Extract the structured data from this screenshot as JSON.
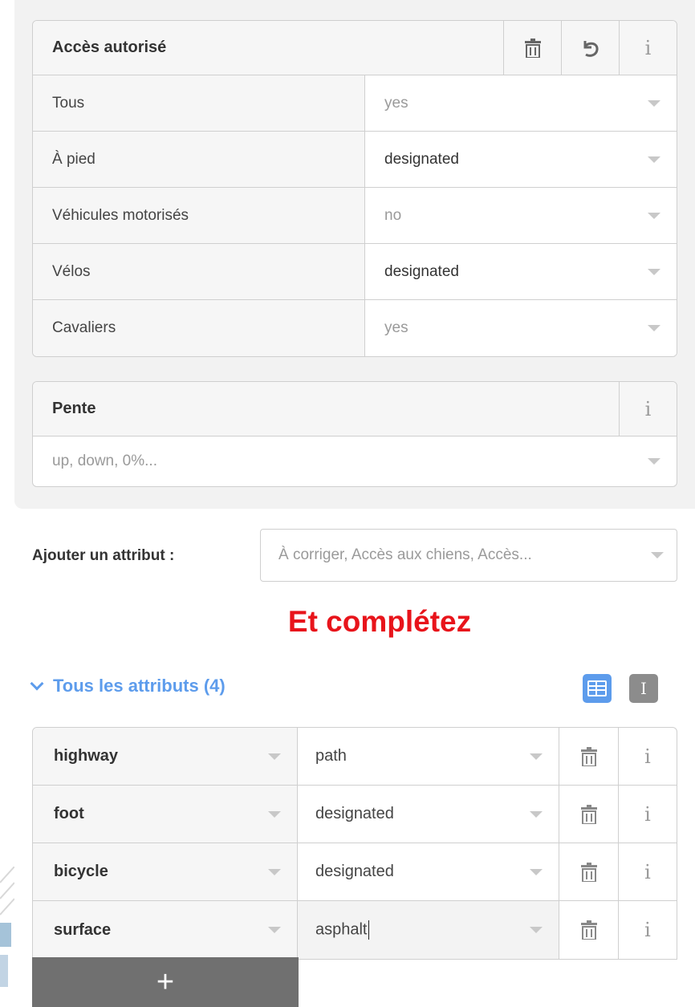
{
  "access_card": {
    "title": "Accès autorisé",
    "delete_icon": "trash-icon",
    "undo_icon": "undo-icon",
    "info_label": "i",
    "rows": [
      {
        "label": "Tous",
        "value": "yes",
        "state": "placeholder"
      },
      {
        "label": "À pied",
        "value": "designated",
        "state": "filled"
      },
      {
        "label": "Véhicules motorisés",
        "value": "no",
        "state": "placeholder"
      },
      {
        "label": "Vélos",
        "value": "designated",
        "state": "filled"
      },
      {
        "label": "Cavaliers",
        "value": "yes",
        "state": "placeholder"
      }
    ]
  },
  "incline_card": {
    "title": "Pente",
    "info_label": "i",
    "placeholder": "up, down, 0%..."
  },
  "add_field": {
    "label": "Ajouter un attribut :",
    "placeholder": "À corriger, Accès aux chiens, Accès..."
  },
  "annotation": {
    "text": "Et complétez",
    "color": "#e8141b"
  },
  "all_tags": {
    "toggle_label": "Tous les attributs (4)",
    "accent": "#5d9cec",
    "text_view_label": "I",
    "rows": [
      {
        "key": "highway",
        "value": "path"
      },
      {
        "key": "foot",
        "value": "designated"
      },
      {
        "key": "bicycle",
        "value": "designated"
      },
      {
        "key": "surface",
        "value": "asphalt"
      }
    ],
    "info_label": "i",
    "add_label": "+"
  }
}
